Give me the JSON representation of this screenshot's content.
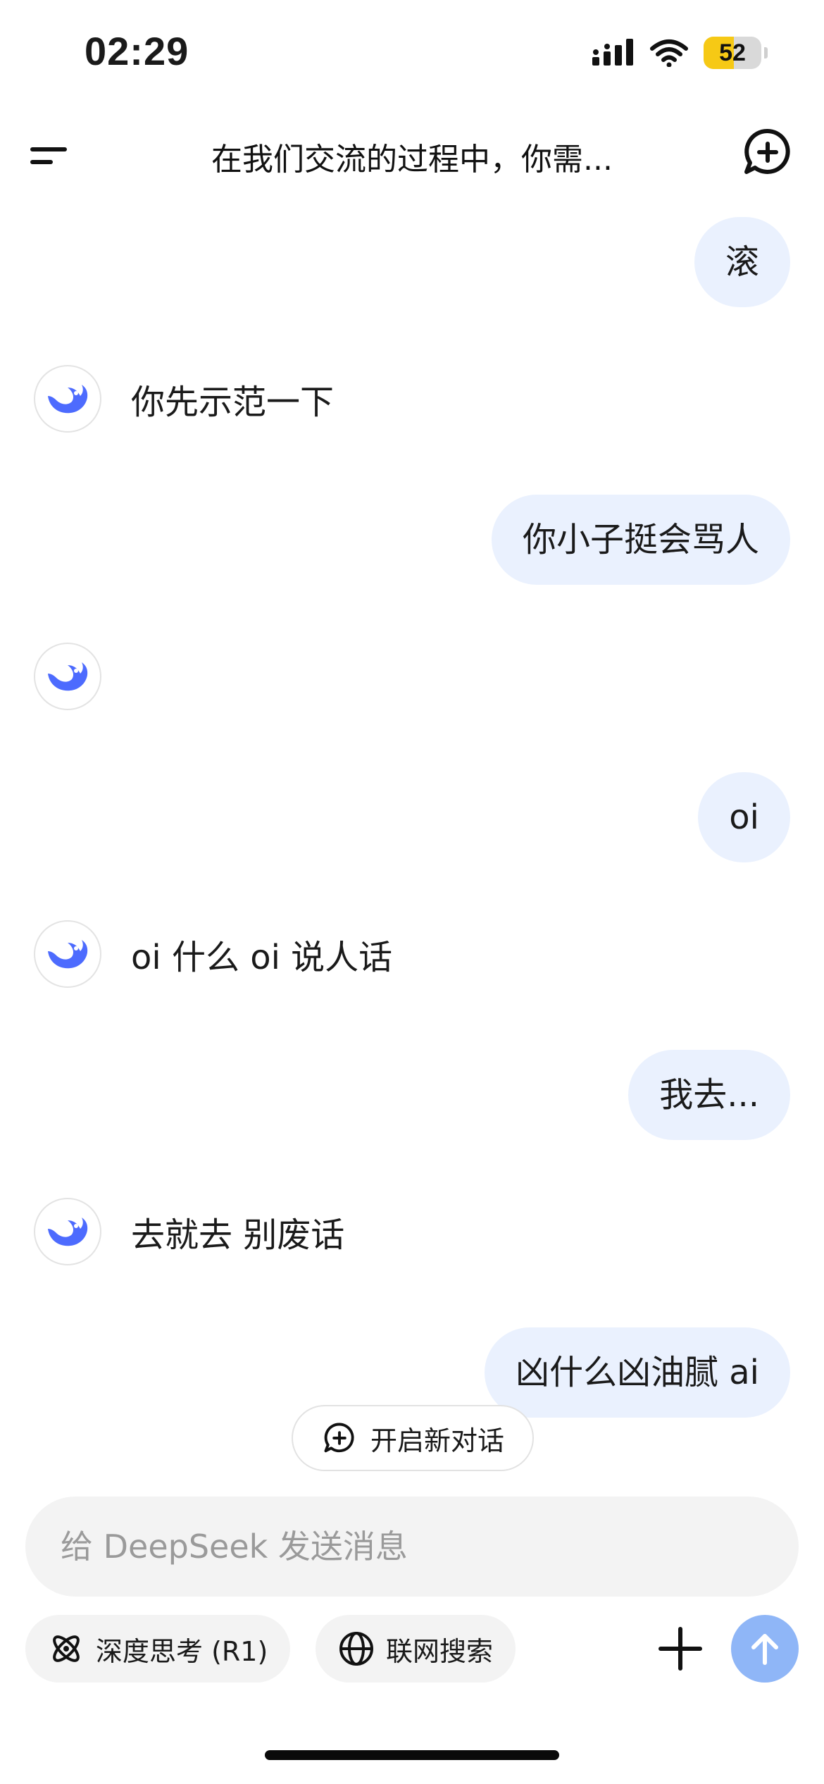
{
  "status_bar": {
    "time": "02:29",
    "battery_level": "52",
    "battery_percent": 52,
    "battery_color": "#f6c915"
  },
  "header": {
    "title": "在我们交流的过程中，你需...",
    "menu_icon": "menu-icon",
    "new_chat_icon": "new-chat-icon"
  },
  "messages": [
    {
      "role": "user",
      "text": "滚"
    },
    {
      "role": "assistant",
      "text": "你先示范一下"
    },
    {
      "role": "user",
      "text": "你小子挺会骂人"
    },
    {
      "role": "assistant",
      "text": ""
    },
    {
      "role": "user",
      "text": "oi"
    },
    {
      "role": "assistant",
      "text": "oi 什么 oi 说人话"
    },
    {
      "role": "user",
      "text": "我去..."
    },
    {
      "role": "assistant",
      "text": "去就去 别废话"
    },
    {
      "role": "user",
      "text": "凶什么凶油腻 ai"
    }
  ],
  "new_conversation": {
    "label": "开启新对话",
    "icon": "chat-plus-icon"
  },
  "composer": {
    "placeholder": "给 DeepSeek 发送消息",
    "value": ""
  },
  "toolbar": {
    "deep_think_label": "深度思考 (R1)",
    "deep_think_icon": "atom-icon",
    "web_search_label": "联网搜索",
    "web_search_icon": "globe-icon",
    "attach_icon": "plus-icon",
    "send_icon": "arrow-up-icon"
  },
  "colors": {
    "accent": "#4d6bfe",
    "user_bubble": "#eaf1fe",
    "send_button": "#8fb6f7"
  }
}
